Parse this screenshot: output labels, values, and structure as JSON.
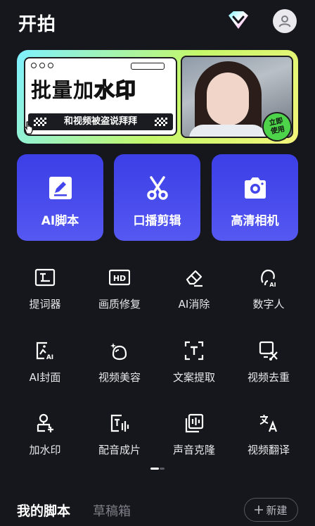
{
  "header": {
    "title": "开拍",
    "vip_icon": "diamond-vip-icon",
    "avatar_icon": "user-avatar-icon"
  },
  "banner": {
    "headline_solid": "批量加",
    "headline_outline": "水印",
    "strip_text": "和视频被盗说拜拜",
    "badge_line1": "立即",
    "badge_line2": "使用"
  },
  "cards": [
    {
      "label": "AI脚本",
      "icon": "edit-pen-icon"
    },
    {
      "label": "口播剪辑",
      "icon": "scissors-icon"
    },
    {
      "label": "高清相机",
      "icon": "camera-icon"
    }
  ],
  "tools": [
    {
      "label": "提词器",
      "icon": "teleprompter-icon"
    },
    {
      "label": "画质修复",
      "icon": "hd-icon"
    },
    {
      "label": "AI消除",
      "icon": "eraser-icon"
    },
    {
      "label": "数字人",
      "icon": "digital-human-icon"
    },
    {
      "label": "AI封面",
      "icon": "ai-cover-icon"
    },
    {
      "label": "视频美容",
      "icon": "beauty-icon"
    },
    {
      "label": "文案提取",
      "icon": "text-extract-icon"
    },
    {
      "label": "视频去重",
      "icon": "video-dedup-icon"
    },
    {
      "label": "加水印",
      "icon": "watermark-icon"
    },
    {
      "label": "配音成片",
      "icon": "dubbing-icon"
    },
    {
      "label": "声音克隆",
      "icon": "voice-clone-icon"
    },
    {
      "label": "视频翻译",
      "icon": "translate-icon"
    }
  ],
  "bottom_tabs": {
    "mine": "我的脚本",
    "draft": "草稿箱",
    "new_label": "新建"
  },
  "colors": {
    "background": "#16171c",
    "card_blue": "#4346ea",
    "badge_green": "#4ed44a"
  }
}
